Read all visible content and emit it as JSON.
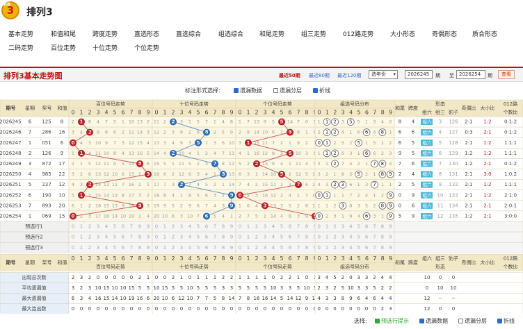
{
  "header": {
    "logo_text": "3",
    "logo_sub": "彩票",
    "title": "排列3"
  },
  "nav": {
    "row1": [
      "基本走势",
      "和值和尾",
      "跨度走势",
      "直选形态",
      "直选综合",
      "组选综合",
      "和尾走势",
      "组三走势",
      "012路走势",
      "大小形态",
      "奇偶形态",
      "质合形态"
    ],
    "row2": [
      "二码走势",
      "百位走势",
      "十位走势",
      "个位走势"
    ]
  },
  "toolbar": {
    "title": "排列3基本走势图",
    "ranges": [
      "最近50期",
      "最近80期",
      "最近120期"
    ],
    "select_value": "选年份",
    "from_issue": "2026245",
    "from_label": "期",
    "to_label": "至",
    "to_issue": "2026254",
    "to_suffix": "期",
    "query": "查看"
  },
  "options": {
    "label": "标注形式选择:",
    "items": [
      {
        "label": "遗漏数据",
        "checked": true
      },
      {
        "label": "遗漏分层",
        "checked": false
      },
      {
        "label": "折线",
        "checked": true
      }
    ]
  },
  "table": {
    "headers": {
      "issue": "期号",
      "week": "星期",
      "prize": "奖号",
      "sum": "和值",
      "bai": "百位号码走势",
      "shi": "十位号码走势",
      "ge": "个位号码走势",
      "zu": "组选号码分布",
      "hewei": "和尾",
      "kuadu": "跨度",
      "xingtai": "形态",
      "xt_sub": [
        "组六",
        "组三",
        "豹子"
      ],
      "jiou": "奇偶比",
      "daxiao": "大小比",
      "lu": "012路",
      "lu2": "个数比",
      "digits": [
        "0",
        "1",
        "2",
        "3",
        "4",
        "5",
        "6",
        "7",
        "8",
        "9"
      ]
    },
    "rows": [
      {
        "issue": "2026245",
        "week": "6",
        "prize": "125",
        "sum": "8",
        "bai": [
          2,
          "1",
          8,
          4,
          7,
          5,
          1,
          10,
          13,
          2
        ],
        "shi": [
          11,
          2,
          "2",
          3,
          1,
          5,
          7,
          1,
          4,
          8
        ],
        "ge": [
          1,
          7,
          13,
          9,
          5,
          "5",
          14,
          7,
          0,
          5
        ],
        "zu": [
          1,
          "1",
          "2",
          3,
          "5",
          5,
          1,
          3,
          4,
          0
        ],
        "hewei": "8",
        "kuadu": "4",
        "xt": [
          "组六",
          "3",
          "126"
        ],
        "jiou": "2:1",
        "daxiao": "1:2",
        "lu": "0:1:2"
      },
      {
        "issue": "2026246",
        "week": "7",
        "prize": "286",
        "sum": "16",
        "bai": [
          3,
          4,
          "2",
          9,
          8,
          6,
          2,
          11,
          14,
          3
        ],
        "shi": [
          12,
          2,
          3,
          8,
          2,
          6,
          "8",
          2,
          5,
          9
        ],
        "ge": [
          2,
          8,
          14,
          10,
          6,
          1,
          "6",
          8,
          1,
          6
        ],
        "zu": [
          2,
          "1",
          "2",
          4,
          1,
          6,
          "6",
          4,
          "8",
          1
        ],
        "hewei": "6",
        "kuadu": "6",
        "xt": [
          "组六",
          "4",
          "127"
        ],
        "jiou": "0:3",
        "daxiao": "2:1",
        "lu": "0:1:2"
      },
      {
        "issue": "2026247",
        "week": "1",
        "prize": "051",
        "sum": "6",
        "bai": [
          "0",
          4,
          3,
          10,
          9,
          7,
          3,
          12,
          15,
          4
        ],
        "shi": [
          13,
          3,
          4,
          9,
          3,
          "5",
          1,
          3,
          6,
          10
        ],
        "ge": [
          3,
          "1",
          15,
          11,
          7,
          2,
          1,
          9,
          2,
          7
        ],
        "zu": [
          "0",
          "1",
          2,
          5,
          2,
          "5",
          1,
          5,
          1,
          2
        ],
        "hewei": "6",
        "kuadu": "5",
        "xt": [
          "组六",
          "5",
          "128"
        ],
        "jiou": "2:1",
        "daxiao": "1:2",
        "lu": "1:1:1"
      },
      {
        "issue": "2026248",
        "week": "2",
        "prize": "126",
        "sum": "9",
        "bai": [
          1,
          "1",
          4,
          11,
          10,
          8,
          4,
          13,
          16,
          5
        ],
        "shi": [
          14,
          4,
          "2",
          10,
          4,
          1,
          2,
          4,
          7,
          11
        ],
        "ge": [
          4,
          1,
          16,
          12,
          8,
          3,
          "6",
          10,
          3,
          8
        ],
        "zu": [
          1,
          "1",
          "2",
          6,
          3,
          1,
          "6",
          6,
          2,
          3
        ],
        "hewei": "9",
        "kuadu": "5",
        "xt": [
          "组六",
          "6",
          "129"
        ],
        "jiou": "1:2",
        "daxiao": "1:2",
        "lu": "1:1:1"
      },
      {
        "issue": "2026249",
        "week": "3",
        "prize": "872",
        "sum": "17",
        "bai": [
          2,
          1,
          5,
          12,
          11,
          9,
          5,
          14,
          "8",
          6
        ],
        "shi": [
          15,
          5,
          1,
          11,
          5,
          2,
          3,
          "7",
          8,
          12
        ],
        "ge": [
          5,
          2,
          "2",
          13,
          9,
          4,
          1,
          11,
          4,
          9
        ],
        "zu": [
          2,
          1,
          "2",
          7,
          4,
          2,
          1,
          "7",
          "8",
          4
        ],
        "hewei": "7",
        "kuadu": "6",
        "xt": [
          "组六",
          "7",
          "130"
        ],
        "jiou": "1:2",
        "daxiao": "2:1",
        "lu": "0:1:2"
      },
      {
        "issue": "2026250",
        "week": "4",
        "prize": "985",
        "sum": "22",
        "bai": [
          3,
          2,
          6,
          13,
          12,
          10,
          6,
          15,
          1,
          "9"
        ],
        "shi": [
          16,
          6,
          2,
          12,
          6,
          3,
          4,
          1,
          "8",
          13
        ],
        "ge": [
          6,
          3,
          1,
          14,
          10,
          "5",
          2,
          12,
          5,
          10
        ],
        "zu": [
          3,
          2,
          1,
          8,
          5,
          "5",
          2,
          1,
          "8",
          "9"
        ],
        "hewei": "2",
        "kuadu": "4",
        "xt": [
          "组六",
          "8",
          "131"
        ],
        "jiou": "2:1",
        "daxiao": "3:0",
        "lu": "1:0:2"
      },
      {
        "issue": "2026251",
        "week": "5",
        "prize": "237",
        "sum": "12",
        "bai": [
          4,
          3,
          "2",
          14,
          13,
          11,
          7,
          16,
          2,
          1
        ],
        "shi": [
          17,
          7,
          3,
          "3",
          7,
          4,
          5,
          2,
          1,
          14
        ],
        "ge": [
          7,
          4,
          2,
          15,
          11,
          1,
          3,
          "7",
          6,
          11
        ],
        "zu": [
          4,
          3,
          "2",
          "3",
          6,
          1,
          3,
          "7",
          1,
          1
        ],
        "hewei": "2",
        "kuadu": "5",
        "xt": [
          "组六",
          "9",
          "132"
        ],
        "jiou": "2:1",
        "daxiao": "1:2",
        "lu": "1:1:1"
      },
      {
        "issue": "2026252",
        "week": "6",
        "prize": "190",
        "sum": "10",
        "bai": [
          5,
          "1",
          1,
          15,
          14,
          12,
          8,
          17,
          3,
          2
        ],
        "shi": [
          18,
          8,
          4,
          1,
          8,
          5,
          6,
          3,
          2,
          "9"
        ],
        "ge": [
          "0",
          5,
          3,
          16,
          12,
          2,
          4,
          1,
          7,
          12
        ],
        "zu": [
          "0",
          "1",
          1,
          1,
          7,
          2,
          4,
          1,
          2,
          "9"
        ],
        "hewei": "0",
        "kuadu": "9",
        "xt": [
          "组六",
          "10",
          "133"
        ],
        "jiou": "2:1",
        "daxiao": "1:2",
        "lu": "2:1:0"
      },
      {
        "issue": "2026253",
        "week": "7",
        "prize": "893",
        "sum": "20",
        "bai": [
          6,
          1,
          2,
          16,
          15,
          13,
          9,
          18,
          "8",
          3
        ],
        "shi": [
          19,
          9,
          5,
          2,
          9,
          6,
          7,
          4,
          3,
          "9"
        ],
        "ge": [
          1,
          6,
          4,
          "3",
          13,
          3,
          5,
          2,
          8,
          13
        ],
        "zu": [
          1,
          1,
          2,
          "3",
          8,
          3,
          5,
          2,
          "8",
          "9"
        ],
        "hewei": "0",
        "kuadu": "6",
        "xt": [
          "组六",
          "11",
          "134"
        ],
        "jiou": "2:1",
        "daxiao": "2:1",
        "lu": "2:0:1"
      },
      {
        "issue": "2026254",
        "week": "1",
        "prize": "069",
        "sum": "15",
        "bai": [
          "0",
          2,
          3,
          17,
          16,
          14,
          10,
          19,
          1,
          4
        ],
        "shi": [
          20,
          10,
          6,
          3,
          10,
          7,
          "6",
          5,
          4,
          1
        ],
        "ge": [
          2,
          7,
          5,
          1,
          14,
          4,
          6,
          3,
          9,
          "9"
        ],
        "zu": [
          "0",
          2,
          3,
          1,
          9,
          4,
          "6",
          3,
          1,
          "9"
        ],
        "hewei": "5",
        "kuadu": "9",
        "xt": [
          "组六",
          "12",
          "135"
        ],
        "jiou": "1:2",
        "daxiao": "2:1",
        "lu": "3:0:0"
      }
    ],
    "preselect": [
      "预选行1",
      "预选行2",
      "预选行3"
    ],
    "stats": [
      {
        "label": "出现总次数",
        "bai": [
          2,
          3,
          2,
          0,
          0,
          0,
          0,
          0,
          2,
          1
        ],
        "shi": [
          0,
          0,
          2,
          1,
          0,
          1,
          1,
          1,
          2,
          2
        ],
        "ge": [
          1,
          1,
          1,
          1,
          0,
          2,
          2,
          1,
          0,
          1
        ],
        "zu": [
          3,
          4,
          5,
          2,
          0,
          3,
          3,
          2,
          4,
          4
        ],
        "xt": [
          "10",
          "0",
          "0"
        ]
      },
      {
        "label": "平均遗漏值",
        "bai": [
          3,
          2,
          3,
          10,
          15,
          10,
          10,
          15,
          5,
          5
        ],
        "shi": [
          10,
          15,
          5,
          5,
          10,
          5,
          5,
          5,
          3,
          3
        ],
        "ge": [
          5,
          5,
          5,
          5,
          10,
          3,
          3,
          5,
          10,
          5
        ],
        "zu": [
          2,
          3,
          2,
          5,
          10,
          3,
          3,
          5,
          2,
          2
        ],
        "xt": [
          "0",
          "10",
          "10"
        ]
      },
      {
        "label": "最大遗漏值",
        "bai": [
          6,
          3,
          4,
          16,
          15,
          14,
          10,
          19,
          16,
          6
        ],
        "shi": [
          20,
          10,
          6,
          12,
          10,
          7,
          7,
          5,
          8,
          14
        ],
        "ge": [
          7,
          8,
          16,
          16,
          14,
          5,
          14,
          12,
          9,
          13
        ],
        "zu": [
          4,
          3,
          3,
          8,
          9,
          6,
          4,
          6,
          4,
          4
        ],
        "xt": [
          "12",
          "--",
          "--"
        ]
      },
      {
        "label": "最大连出数",
        "bai": [
          0,
          0,
          0,
          0,
          0,
          0,
          0,
          0,
          0,
          0
        ],
        "shi": [
          0,
          0,
          0,
          0,
          0,
          0,
          0,
          0,
          0,
          0
        ],
        "ge": [
          0,
          0,
          0,
          0,
          0,
          0,
          0,
          0,
          0,
          0
        ],
        "zu": [
          0,
          0,
          0,
          0,
          0,
          0,
          0,
          0,
          2,
          3
        ],
        "xt": [
          "12",
          "0",
          "0"
        ]
      }
    ]
  },
  "footer": {
    "label": "选择:",
    "items": [
      {
        "label": "预选行提示",
        "checked": true
      },
      {
        "label": "遗漏数据",
        "checked": true
      },
      {
        "label": "遗漏分层",
        "checked": false
      },
      {
        "label": "折线",
        "checked": true
      }
    ]
  },
  "colors": {
    "red": "#b8202a",
    "blue": "#2e6db5",
    "header_bg": "#f2e8c6",
    "row_bg": "#fdf8e4",
    "label_bg": "#e6eef8"
  }
}
